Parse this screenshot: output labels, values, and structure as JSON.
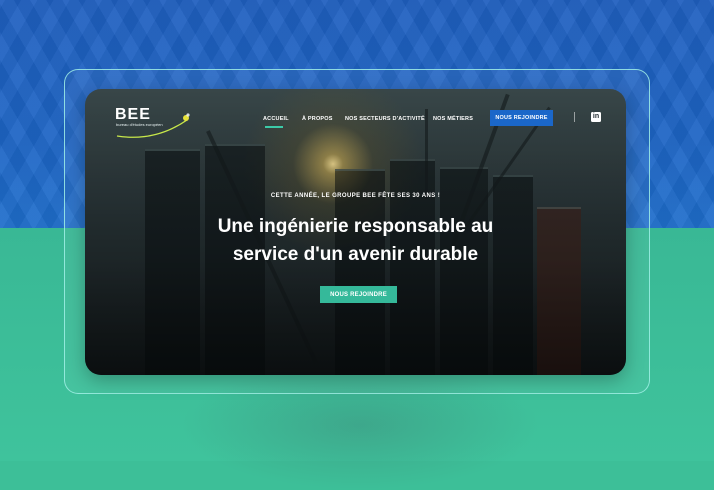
{
  "brand": {
    "name": "BEE",
    "tagline": "bureau d'études européen"
  },
  "nav": {
    "items": [
      {
        "label": "Accueil",
        "active": true
      },
      {
        "label": "À propos",
        "active": false
      },
      {
        "label": "Nos secteurs d'activité",
        "active": false
      },
      {
        "label": "Nos métiers",
        "active": false
      }
    ],
    "cta_label": "Nous rejoindre",
    "social_icon": "linkedin-icon",
    "social_glyph": "in"
  },
  "hero": {
    "kicker": "Cette année, le groupe BEE fête ses 30 ans !",
    "headline_line1": "Une ingénierie responsable au",
    "headline_line2": "service d'un avenir durable",
    "cta_label": "Nous rejoindre"
  },
  "colors": {
    "blue_band": "#1d64c4",
    "green_band": "#3dbf98",
    "cta_blue": "#1b67c9",
    "cta_green": "#35b99a",
    "accent": "#3ccaa8"
  }
}
